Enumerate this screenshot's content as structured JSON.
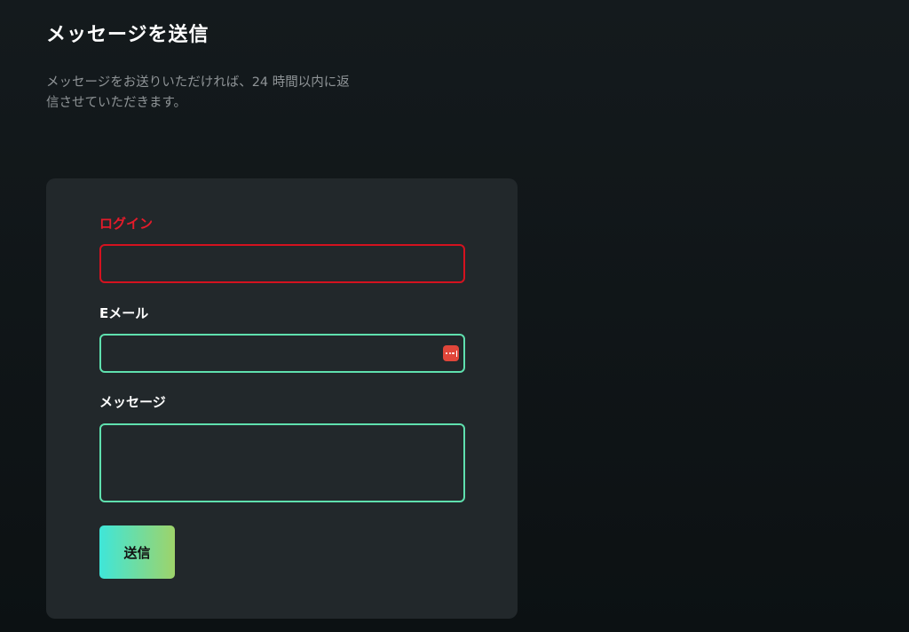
{
  "header": {
    "title": "メッセージを送信",
    "description_line1": "メッセージをお送りいただければ、24 時間以内に返",
    "description_line2": "信させていただきます。"
  },
  "form": {
    "login": {
      "label": "ログイン",
      "value": "",
      "state": "error"
    },
    "email": {
      "label": "Eメール",
      "value": "",
      "icon": "password-manager-icon"
    },
    "message": {
      "label": "メッセージ",
      "value": ""
    },
    "submit_label": "送信"
  },
  "colors": {
    "background": "#0f1416",
    "card": "#22282b",
    "error": "#e51b2a",
    "valid_border": "#5fe0ae",
    "button_gradient_start": "#3fe6d9",
    "button_gradient_end": "#9ed36a",
    "autofill_icon": "#e0463a",
    "muted_text": "#8f9497"
  }
}
